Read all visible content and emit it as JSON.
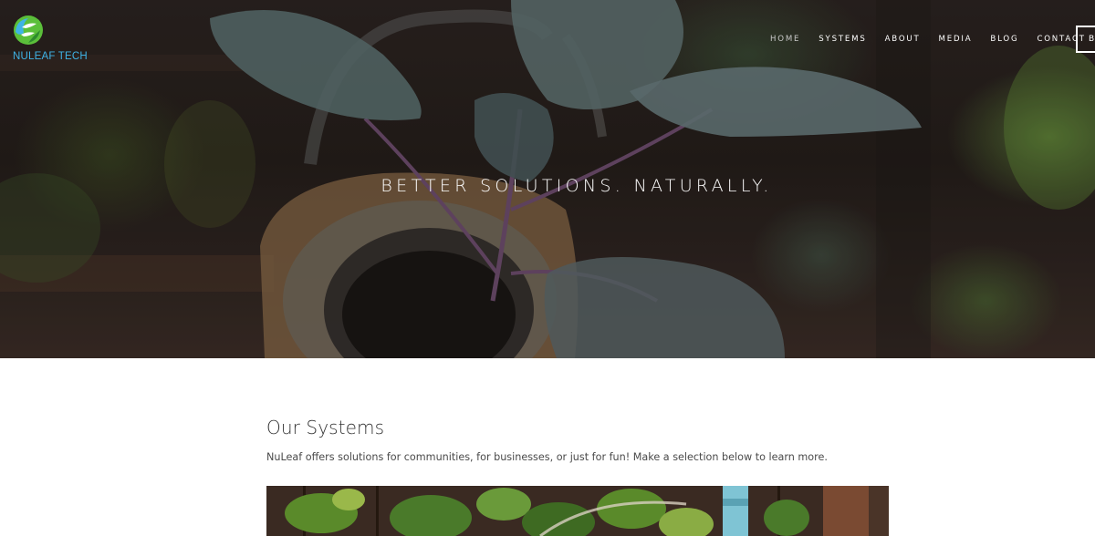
{
  "brand": {
    "name": "NULEAF TECH",
    "logo_icon": "leaf-circle-icon",
    "colors": {
      "blue": "#3fb3e6",
      "green": "#5bbf3a"
    }
  },
  "nav": {
    "items": [
      {
        "label": "HOME",
        "active": true
      },
      {
        "label": "SYSTEMS",
        "active": false
      },
      {
        "label": "ABOUT",
        "active": false
      },
      {
        "label": "MEDIA",
        "active": false
      },
      {
        "label": "BLOG",
        "active": false
      },
      {
        "label": "CONTACT",
        "active": false
      }
    ],
    "button_label": "B"
  },
  "hero": {
    "title": "BETTER SOLUTIONS. NATURALLY."
  },
  "systems": {
    "title": "Our Systems",
    "description": "NuLeaf offers solutions for communities, for businesses, or just for fun! Make a selection below to learn more."
  }
}
